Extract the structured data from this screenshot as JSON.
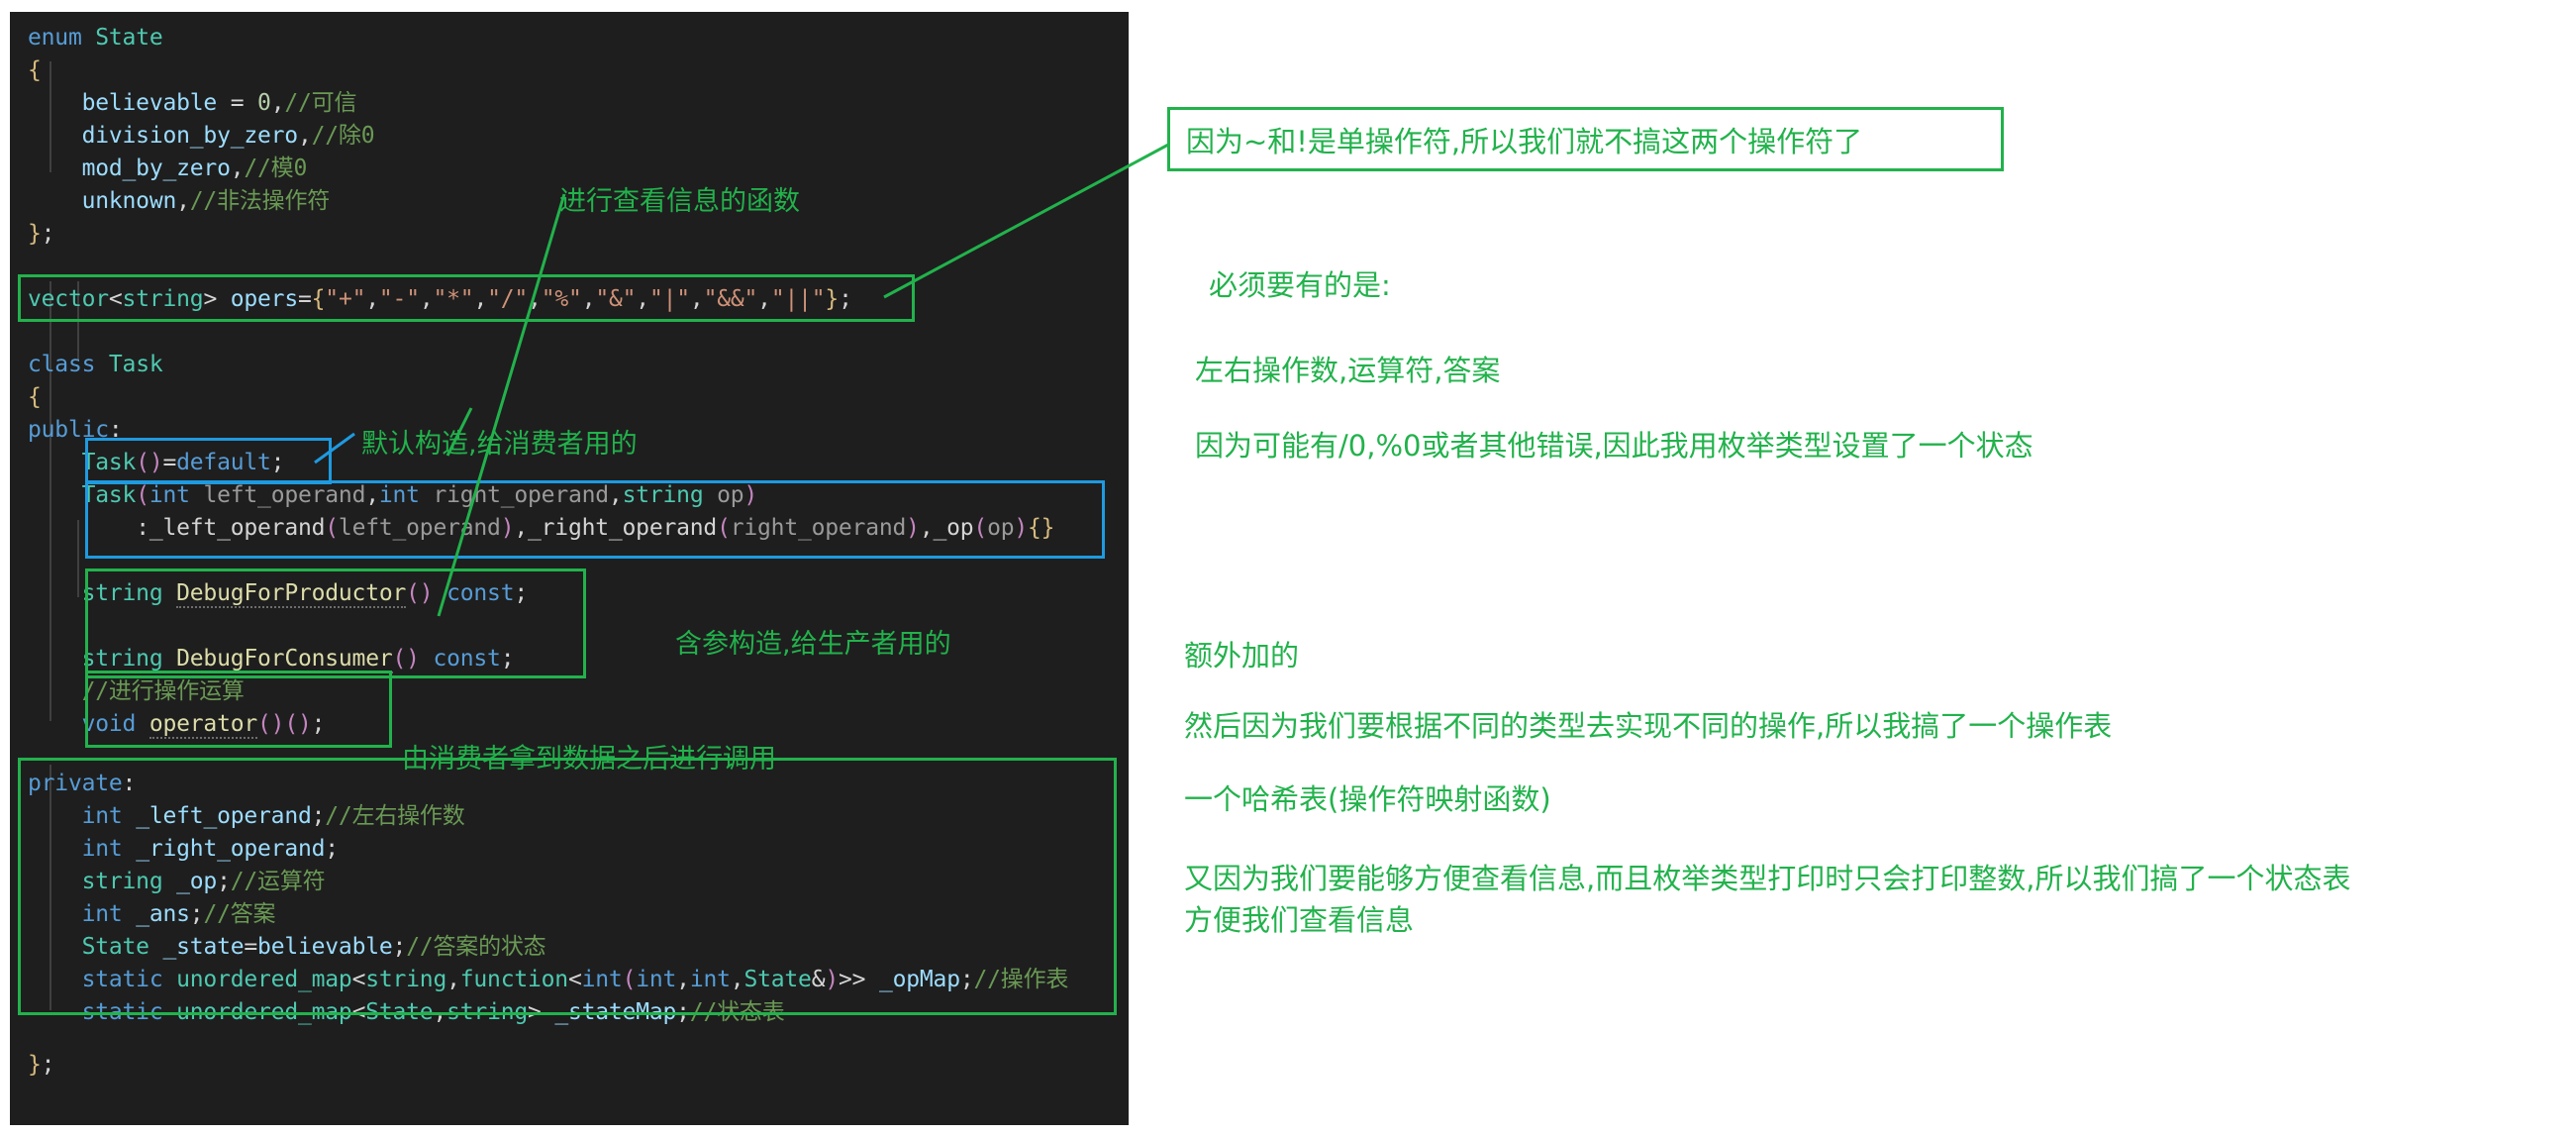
{
  "colors": {
    "editor_bg": "#1e1e1e",
    "page_bg": "#ffffff",
    "annotation_green": "#22b24c",
    "highlight_blue": "#1e9ae0",
    "comment_green": "#6a9955",
    "keyword_blue": "#569cd6",
    "type_teal": "#4ec9b0",
    "brace_gold": "#d7ba7d"
  },
  "code": {
    "lines": [
      {
        "id": "l1",
        "text": "enum State"
      },
      {
        "id": "l2",
        "text": "{"
      },
      {
        "id": "l3",
        "text": "    believable = 0,//可信"
      },
      {
        "id": "l4",
        "text": "    division_by_zero,//除0"
      },
      {
        "id": "l5",
        "text": "    mod_by_zero,//模0"
      },
      {
        "id": "l6",
        "text": "    unknown,//非法操作符"
      },
      {
        "id": "l7",
        "text": "};"
      },
      {
        "id": "l8",
        "text": ""
      },
      {
        "id": "l9",
        "text": "vector<string> opers={\"+\",\"-\",\"*\",\"/\",\"%\",\"&\",\"|\",\"&&\",\"||\"};"
      },
      {
        "id": "l10",
        "text": ""
      },
      {
        "id": "l11",
        "text": "class Task"
      },
      {
        "id": "l12",
        "text": "{"
      },
      {
        "id": "l13",
        "text": "public:"
      },
      {
        "id": "l14",
        "text": "    Task()=default;"
      },
      {
        "id": "l15",
        "text": "    Task(int left_operand,int right_operand,string op)"
      },
      {
        "id": "l16",
        "text": "        :_left_operand(left_operand),_right_operand(right_operand),_op(op){}"
      },
      {
        "id": "l17",
        "text": ""
      },
      {
        "id": "l18",
        "text": "    string DebugForProductor() const;"
      },
      {
        "id": "l19",
        "text": ""
      },
      {
        "id": "l20",
        "text": "    string DebugForConsumer() const;"
      },
      {
        "id": "l21",
        "text": "    //进行操作运算"
      },
      {
        "id": "l22",
        "text": "    void operator()();"
      },
      {
        "id": "l23",
        "text": ""
      },
      {
        "id": "l24",
        "text": "private:"
      },
      {
        "id": "l25",
        "text": "    int _left_operand;//左右操作数"
      },
      {
        "id": "l26",
        "text": "    int _right_operand;"
      },
      {
        "id": "l27",
        "text": "    string _op;//运算符"
      },
      {
        "id": "l28",
        "text": "    int _ans;//答案"
      },
      {
        "id": "l29",
        "text": "    State _state=believable;//答案的状态"
      },
      {
        "id": "l30",
        "text": "    static unordered_map<string,function<int(int,int,State&)>> _opMap;//操作表"
      },
      {
        "id": "l31",
        "text": "    static unordered_map<State,string> _stateMap;//状态表"
      },
      {
        "id": "l32",
        "text": "};"
      }
    ]
  },
  "annotations": {
    "view_info_function": "进行查看信息的函数",
    "default_ctor": "默认构造,给消费者用的",
    "param_ctor": "含参构造,给生产者用的",
    "consumer_call": "由消费者拿到数据之后进行调用",
    "unary_operators_note": "因为~和!是单操作符,所以我们就不搞这两个操作符了"
  },
  "notes": {
    "must_have_title": "必须要有的是:",
    "must_have_items": "左右操作数,运算符,答案",
    "state_reason": "因为可能有/0,%0或者其他错误,因此我用枚举类型设置了一个状态",
    "extra_title": "额外加的",
    "op_table_reason": "然后因为我们要根据不同的类型去实现不同的操作,所以我搞了一个操作表",
    "hash_table": "一个哈希表(操作符映射函数)",
    "state_table_reason_line1": "又因为我们要能够方便查看信息,而且枚举类型打印时只会打印整数,所以我们搞了一个状态表",
    "state_table_reason_line2": "方便我们查看信息"
  },
  "highlight_boxes": [
    {
      "id": "opers-box",
      "label": "operators-vector-highlight",
      "color": "green"
    },
    {
      "id": "default-ctor-box",
      "label": "default-constructor-highlight",
      "color": "blue"
    },
    {
      "id": "param-ctor-box",
      "label": "param-constructor-highlight",
      "color": "blue"
    },
    {
      "id": "debug-box",
      "label": "debug-methods-highlight",
      "color": "green"
    },
    {
      "id": "operator-box",
      "label": "call-operator-highlight",
      "color": "green"
    },
    {
      "id": "private-box",
      "label": "private-members-highlight",
      "color": "green"
    }
  ]
}
